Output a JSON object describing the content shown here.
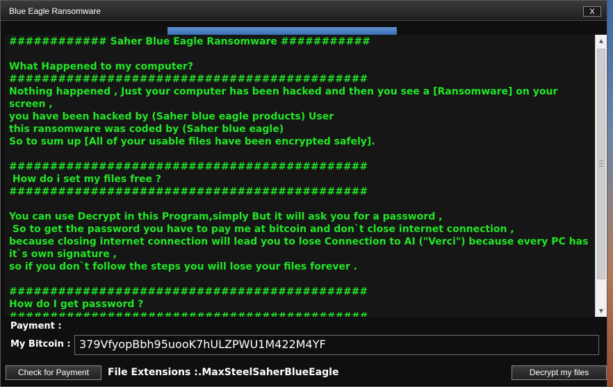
{
  "window": {
    "title": "Blue  Eagle Ransomware",
    "close_label": "X"
  },
  "progress": {
    "value_percent": 100
  },
  "message": {
    "text": "############ Saher Blue Eagle Ransomware ###########\n\nWhat Happened to my computer?\n############################################\nNothing happened , Just your computer has been hacked and then you see a [Ransomware] on your screen ,\nyou have been hacked by (Saher blue eagle products) User\nthis ransomware was coded by (Saher blue eagle)\nSo to sum up [All of your usable files have been encrypted safely].\n\n############################################\n How do i set my files free ?\n############################################\n\nYou can use Decrypt in this Program,simply But it will ask you for a password ,\n So to get the password you have to pay me at bitcoin and don`t close internet connection ,\nbecause closing internet connection will lead you to lose Connection to AI (\"Verci\") because every PC has it`s own signature ,\nso if you don`t follow the steps you will lose your files forever .\n\n############################################\nHow do I get password ?\n############################################"
  },
  "payment": {
    "label": "Payment :",
    "bitcoin_label": "My Bitcoin :",
    "bitcoin_value": "379VfyopBbh95uooK7hULZPWU1M422M4YF"
  },
  "footer": {
    "check_button": "Check for Payment",
    "extensions_label": "File Extensions :",
    "extensions_value": ".MaxSteelSaherBlueEagle",
    "decrypt_button": "Decrypt my files"
  },
  "colors": {
    "message_text": "#22e626",
    "progress_fill": "#4a7fc4",
    "window_bg": "#0f0f0f"
  },
  "icons": {
    "scroll_up": "scroll-up-arrow-icon",
    "scroll_down": "scroll-down-arrow-icon"
  }
}
